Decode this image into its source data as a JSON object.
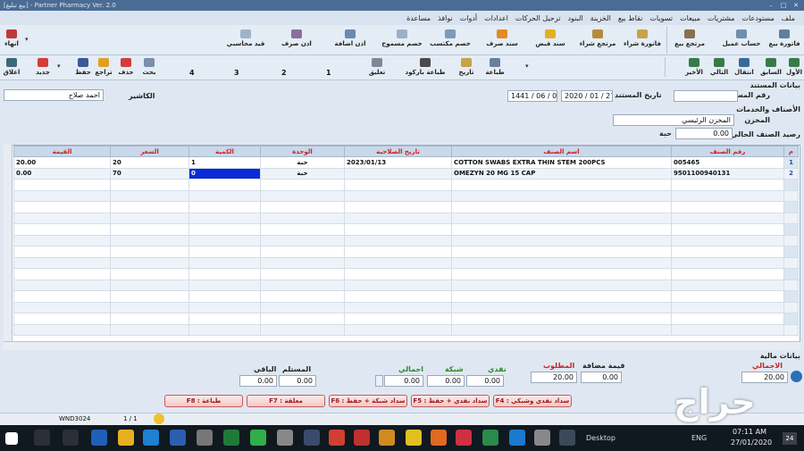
{
  "window": {
    "title": "[بيع تبليغ] - Partner Pharmacy Ver. 2.0"
  },
  "menu": [
    "ملف",
    "مستودعات",
    "مشتريات",
    "مبيعات",
    "تسويات",
    "نقاط بيع",
    "الخزينة",
    "البنود",
    "ترحيل الحركات",
    "اعدادات",
    "أدوات",
    "نوافذ",
    "مساعدة"
  ],
  "toolbar1": {
    "items": [
      "فاتورة بيع",
      "حساب عميل",
      "مرتجع بيع",
      "فاتورة شراء",
      "مرتجع شراء",
      "سند قبض",
      "سند صرف",
      "خصم مكتسب",
      "خصم مسموح",
      "اذن اضافة",
      "اذن صرف",
      "قيد محاسبي"
    ],
    "right_exit": "انهاء"
  },
  "toolbar2": {
    "nav": [
      "الأول",
      "السابق",
      "التالي",
      "الأخير",
      "انتقال"
    ],
    "actions": [
      "طباعة",
      "تاريخ",
      "طباعة باركود",
      "تعليق"
    ],
    "tabs": [
      "1",
      "2",
      "3",
      "4"
    ],
    "edit": [
      "بحث",
      "حذف",
      "تراجع",
      "حفظ",
      "جديد",
      "اغلاق"
    ]
  },
  "doc": {
    "section_title": "بيانات المستند",
    "doc_no_label": "رقم المستند",
    "doc_no": "",
    "date_label": "تاريخ المستند",
    "date": "2020 / 01 / 27",
    "hijri": "1441 / 06 / 02",
    "cashier_label": "الكاشير",
    "cashier": "احمد صلاح"
  },
  "items_section": {
    "title": "الأصناف والخدمات",
    "store_label": "المخزن",
    "store": "المخزن الرئيسي",
    "balance_label": "رصيد الصنف الحالي",
    "balance": "0.00",
    "unit": "حبة"
  },
  "table": {
    "headers": [
      "م",
      "رقم الصنف",
      "اسم الصنف",
      "تاريخ الصلاحية",
      "الوحدة",
      "الكمية",
      "السعر",
      "القيمة"
    ],
    "rows": [
      [
        "1",
        "005465",
        "COTTON SWABS EXTRA THIN STEM 200PCS",
        "2023/01/13",
        "حبة",
        "1",
        "20",
        "20.00"
      ],
      [
        "2",
        "9501100940131",
        "OMEZYN 20 MG 15 CAP",
        "",
        "حبة",
        "0",
        "70",
        "0.00"
      ]
    ]
  },
  "finance": {
    "title": "بيانات مالية",
    "total_label": "الاجمالي",
    "total": "20.00",
    "vat_label": "قيمة مضافة",
    "vat": "0.00",
    "due_label": "المطلوب",
    "due": "20.00",
    "cash_label": "نقدي",
    "cash": "0.00",
    "network_label": "شبكة",
    "network": "0.00",
    "sum_label": "اجمالي",
    "sum": "0.00",
    "received_label": "المستلم",
    "received": "0.00",
    "remaining_label": "الباقي",
    "remaining": "0.00"
  },
  "fkeys": [
    "F4 : سداد نقدي وشبكي",
    "F5 : سداد نقدي + حفظ",
    "F6 : سداد شبكة + حفظ",
    "F7 : معلقة",
    "F8 : طباعة"
  ],
  "status": {
    "user": "WND3024",
    "page": "1 / 1"
  },
  "taskbar": {
    "desktop": "Desktop",
    "time": "07:11 AM",
    "date": "27/01/2020",
    "lang": "ENG",
    "notif": "24"
  },
  "watermark": "حراج"
}
